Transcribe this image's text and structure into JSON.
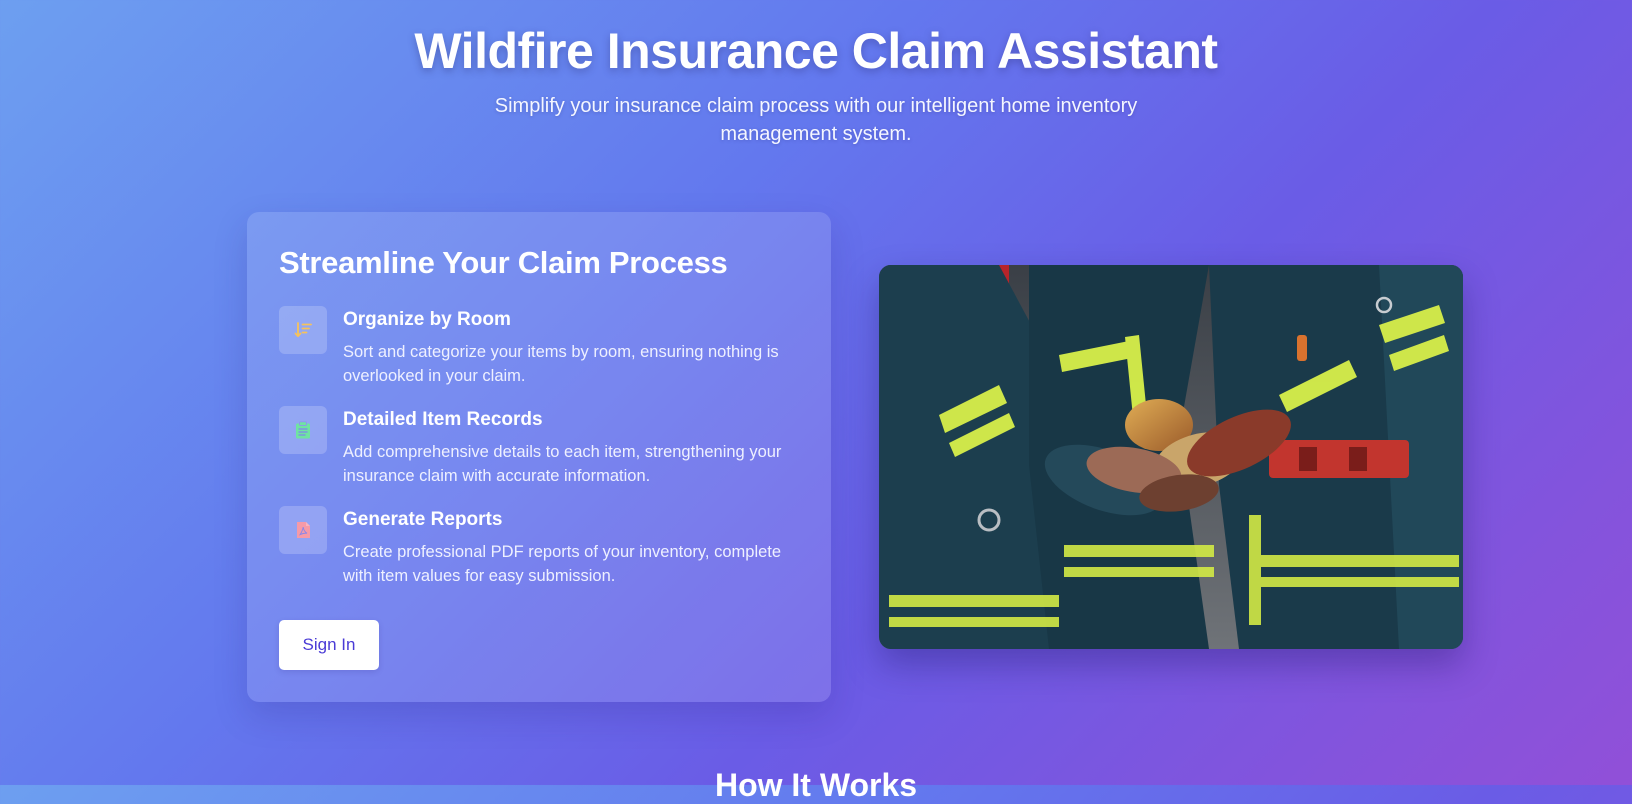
{
  "hero": {
    "title": "Wildfire Insurance Claim Assistant",
    "subtitle": "Simplify your insurance claim process with our intelligent home inventory management system."
  },
  "card": {
    "title": "Streamline Your Claim Process",
    "features": [
      {
        "icon": "sort-list-icon",
        "icon_color": "#f6c25a",
        "title": "Organize by Room",
        "description": "Sort and categorize your items by room, ensuring nothing is overlooked in your claim."
      },
      {
        "icon": "clipboard-list-icon",
        "icon_color": "#6fe3a2",
        "title": "Detailed Item Records",
        "description": "Add comprehensive details to each item, strengthening your insurance claim with accurate information."
      },
      {
        "icon": "pdf-file-icon",
        "icon_color": "#f59aa8",
        "title": "Generate Reports",
        "description": "Create professional PDF reports of your inventory, complete with item values for easy submission."
      }
    ],
    "signin_label": "Sign In"
  },
  "photo": {
    "subject": "firefighters-stacking-gloved-hands"
  },
  "next_section": {
    "title": "How It Works"
  },
  "colors": {
    "gradient_start": "#6d9ff0",
    "gradient_end": "#9150d8",
    "button_text": "#4a3bd6",
    "reflective_stripe": "#d8f04a",
    "turnout_gear": "#1c3e4e"
  }
}
